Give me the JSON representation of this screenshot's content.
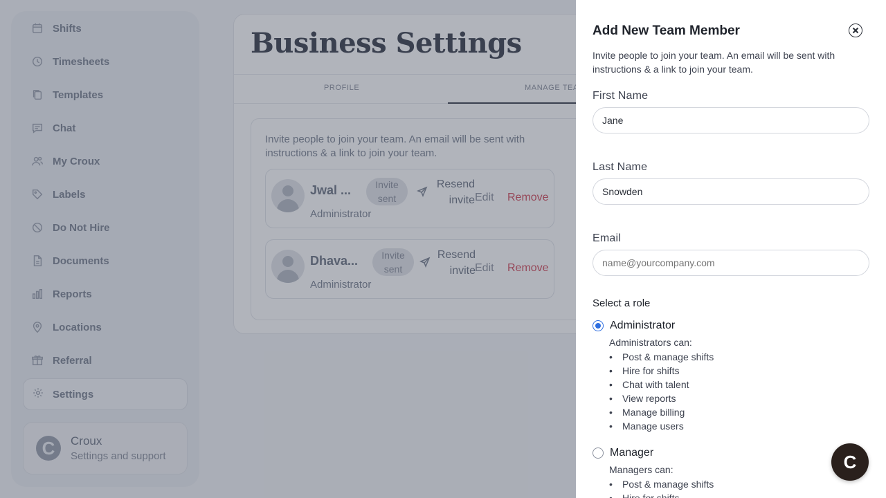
{
  "sidebar": {
    "items": [
      {
        "label": "Shifts",
        "icon": "calendar-icon"
      },
      {
        "label": "Timesheets",
        "icon": "clock-icon"
      },
      {
        "label": "Templates",
        "icon": "copy-icon"
      },
      {
        "label": "Chat",
        "icon": "chat-icon"
      },
      {
        "label": "My Croux",
        "icon": "users-icon"
      },
      {
        "label": "Labels",
        "icon": "tag-icon"
      },
      {
        "label": "Do Not Hire",
        "icon": "ban-icon"
      },
      {
        "label": "Documents",
        "icon": "document-icon"
      },
      {
        "label": "Reports",
        "icon": "bar-chart-icon"
      },
      {
        "label": "Locations",
        "icon": "map-pin-icon"
      },
      {
        "label": "Referral",
        "icon": "gift-icon"
      }
    ],
    "settings_label": "Settings",
    "account": {
      "name": "Croux",
      "subtitle": "Settings and support",
      "logo_glyph": "C"
    }
  },
  "main": {
    "title": "Business Settings",
    "tabs": [
      {
        "label": "PROFILE"
      },
      {
        "label": "MANAGE TEAM"
      }
    ],
    "team_description": "Invite people to join your team. An email will be sent with instructions & a link to join your team.",
    "members": [
      {
        "name": "Jwal ...",
        "badge": "Invite sent",
        "resend": "Resend invite",
        "edit": "Edit",
        "remove": "Remove",
        "role": "Administrator"
      },
      {
        "name": "Dhava...",
        "badge": "Invite sent",
        "resend": "Resend invite",
        "edit": "Edit",
        "remove": "Remove",
        "role": "Administrator"
      }
    ]
  },
  "drawer": {
    "title": "Add New Team Member",
    "description": "Invite people to join your team. An email will be sent with instructions & a link to join your team.",
    "first_name": {
      "label": "First Name",
      "value": "Jane"
    },
    "last_name": {
      "label": "Last Name",
      "value": "Snowden"
    },
    "email": {
      "label": "Email",
      "value": "",
      "placeholder": "name@yourcompany.com"
    },
    "role_heading": "Select a role",
    "roles": [
      {
        "name": "Administrator",
        "selected": true,
        "can": "Administrators can:",
        "permissions": [
          "Post & manage shifts",
          "Hire for shifts",
          "Chat with talent",
          "View reports",
          "Manage billing",
          "Manage users"
        ]
      },
      {
        "name": "Manager",
        "selected": false,
        "can": "Managers can:",
        "permissions": [
          "Post & manage shifts",
          "Hire for shifts"
        ]
      }
    ]
  },
  "chat_fab": {
    "glyph": "C"
  },
  "colors": {
    "accent": "#2f6fe0",
    "danger": "#d24a5a",
    "fab": "#2a201c"
  }
}
